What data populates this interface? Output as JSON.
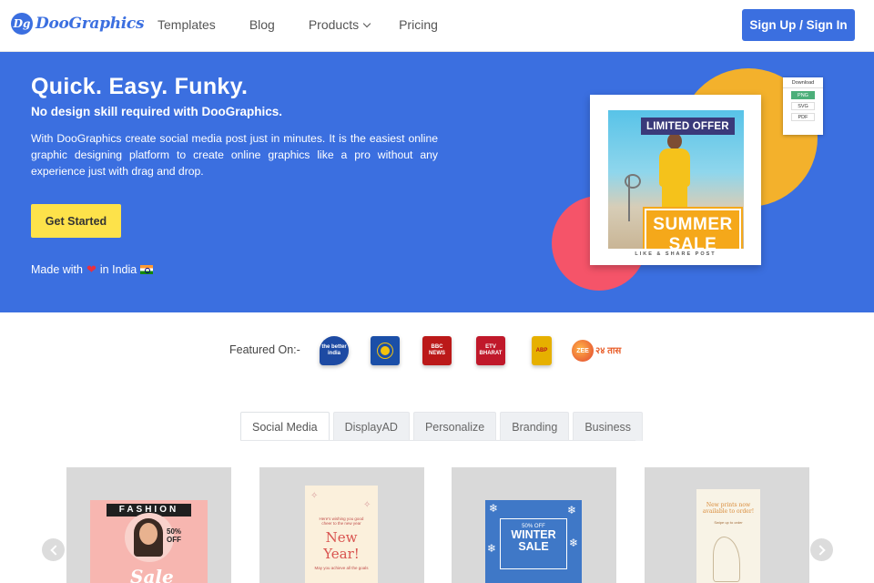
{
  "nav": {
    "logo_mark": "Dg",
    "logo_text": "DooGraphics",
    "links": {
      "templates": "Templates",
      "blog": "Blog",
      "products": "Products",
      "pricing": "Pricing"
    },
    "signin": "Sign Up / Sign In"
  },
  "hero": {
    "title": "Quick. Easy. Funky.",
    "subtitle": "No design skill required with DooGraphics.",
    "description": "With DooGraphics create social media post just in minutes. It is the easiest online graphic designing platform to create online graphics like a pro without any experience just with drag and drop.",
    "cta": "Get Started",
    "made_with_prefix": "Made with",
    "made_with_suffix": "in India",
    "preview": {
      "limited": "LIMITED OFFER",
      "sale_line1": "SUMMER",
      "sale_line2": "SALE",
      "footer": "LIKE & SHARE POST",
      "download_title": "Download",
      "download_options": [
        "PNG",
        "SVG",
        "PDF"
      ]
    },
    "colors": {
      "background": "#3b6fe0",
      "cta": "#fde24a",
      "circle_yellow": "#f3b12c",
      "circle_red": "#f55469"
    }
  },
  "featured": {
    "label": "Featured On:-",
    "logos": {
      "better_india": "the better india",
      "dd": "",
      "bbc": "BBC NEWS",
      "etv": "ETV BHARAT",
      "abp": "ABP",
      "zee": "ZEE २४ तास"
    }
  },
  "tabs": [
    "Social Media",
    "DisplayAD",
    "Personalize",
    "Branding",
    "Business"
  ],
  "active_tab": "Social Media",
  "cards": {
    "fashion": {
      "title": "FASHION",
      "offer_pct": "50%",
      "offer_word": "OFF",
      "script": "Sale"
    },
    "new_year": {
      "small_text": "Here's wishing you good cheer to the new year",
      "title_line1": "New",
      "title_line2": "Year!",
      "footer_text": "May you achieve all the goals"
    },
    "winter": {
      "pct": "50% OFF",
      "line1": "WINTER",
      "line2": "SALE"
    },
    "prints": {
      "heading": "New prints now available to order!",
      "sub": "Swipe up to order"
    }
  }
}
